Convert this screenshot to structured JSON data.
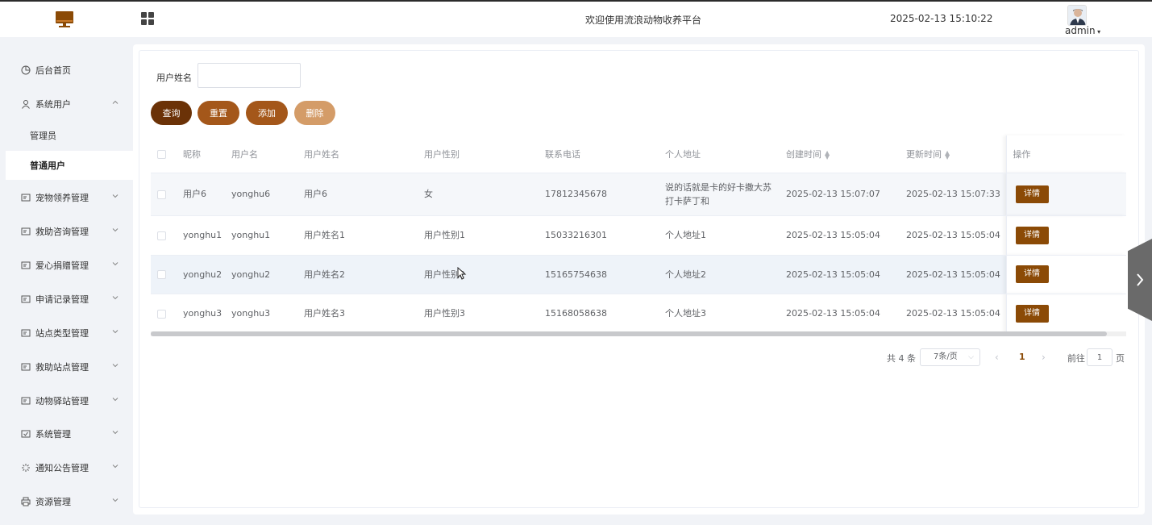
{
  "header": {
    "title": "欢迎使用流浪动物收养平台",
    "datetime": "2025-02-13 15:10:22",
    "username": "admin",
    "logo_icon": "monitor-icon",
    "menu_icon": "grid-icon",
    "brand_color": "#8b4a06"
  },
  "sidebar": {
    "items": [
      {
        "label": "后台首页",
        "icon": "pie-chart-icon"
      },
      {
        "label": "系统用户",
        "icon": "user-icon",
        "expanded": true
      },
      {
        "label": "宠物领养管理",
        "icon": "card-icon"
      },
      {
        "label": "救助咨询管理",
        "icon": "card-icon"
      },
      {
        "label": "爱心捐赠管理",
        "icon": "card-icon"
      },
      {
        "label": "申请记录管理",
        "icon": "card-icon"
      },
      {
        "label": "站点类型管理",
        "icon": "card-icon"
      },
      {
        "label": "救助站点管理",
        "icon": "card-icon"
      },
      {
        "label": "动物驿站管理",
        "icon": "card-icon"
      },
      {
        "label": "系统管理",
        "icon": "check-box-icon"
      },
      {
        "label": "通知公告管理",
        "icon": "loading-icon"
      },
      {
        "label": "资源管理",
        "icon": "printer-icon"
      }
    ],
    "sub_items": [
      {
        "label": "管理员"
      },
      {
        "label": "普通用户",
        "active": true
      }
    ]
  },
  "search": {
    "label": "用户姓名",
    "value": "",
    "placeholder": ""
  },
  "buttons": {
    "query": "查询",
    "reset": "重置",
    "add": "添加",
    "delete": "删除"
  },
  "table": {
    "columns": [
      "昵称",
      "用户名",
      "用户姓名",
      "用户性别",
      "联系电话",
      "个人地址",
      "创建时间",
      "更新时间",
      "操作"
    ],
    "rows": [
      {
        "nickname": "用户6",
        "username": "yonghu6",
        "name": "用户6",
        "gender": "女",
        "phone": "17812345678",
        "address": "说的话就是卡的好卡撒大苏打卡萨丁和",
        "created": "2025-02-13 15:07:07",
        "updated": "2025-02-13 15:07:33",
        "action": "详情"
      },
      {
        "nickname": "yonghu1",
        "username": "yonghu1",
        "name": "用户姓名1",
        "gender": "用户性别1",
        "phone": "15033216301",
        "address": "个人地址1",
        "created": "2025-02-13 15:05:04",
        "updated": "2025-02-13 15:05:04",
        "action": "详情"
      },
      {
        "nickname": "yonghu2",
        "username": "yonghu2",
        "name": "用户姓名2",
        "gender": "用户性别2",
        "phone": "15165754638",
        "address": "个人地址2",
        "created": "2025-02-13 15:05:04",
        "updated": "2025-02-13 15:05:04",
        "action": "详情"
      },
      {
        "nickname": "yonghu3",
        "username": "yonghu3",
        "name": "用户姓名3",
        "gender": "用户性别3",
        "phone": "15168058638",
        "address": "个人地址3",
        "created": "2025-02-13 15:05:04",
        "updated": "2025-02-13 15:05:04",
        "action": "详情"
      }
    ]
  },
  "pagination": {
    "total": "共 4 条",
    "page_size": "7条/页",
    "current_page": "1",
    "goto_label": "前往",
    "goto_value": "1",
    "page_suffix": "页"
  }
}
